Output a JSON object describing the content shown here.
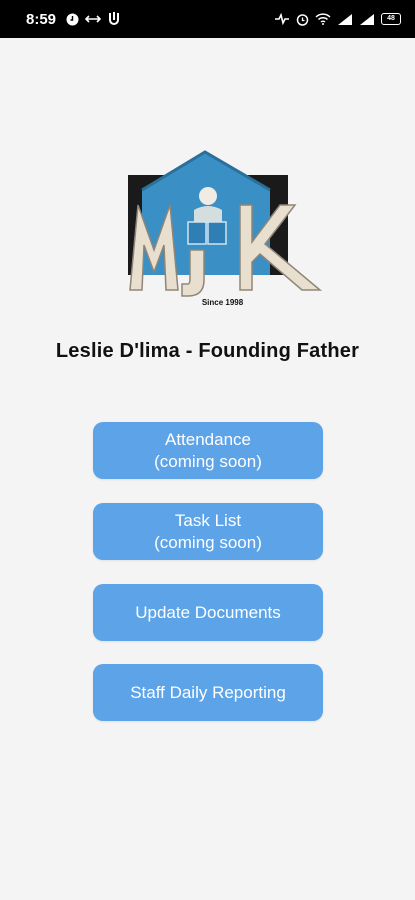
{
  "status_bar": {
    "time": "8:59",
    "battery": "48",
    "icons_left": [
      "clock-icon",
      "link-icon",
      "notification-icon"
    ],
    "icons_right": [
      "data-saver-icon",
      "alarm-icon",
      "wifi-icon",
      "signal-icon",
      "signal-icon"
    ]
  },
  "logo": {
    "letters": "MJK",
    "since": "Since 1998",
    "colors": {
      "house": "#3a8fc4",
      "letters": "#e9dfcf",
      "backdrop": "#1a1a1a"
    }
  },
  "page_title": "Leslie D'lima - Founding Father",
  "menu": [
    {
      "line1": "Attendance",
      "line2": "(coming soon)"
    },
    {
      "line1": "Task List",
      "line2": "(coming soon)"
    },
    {
      "line1": "Update Documents",
      "line2": ""
    },
    {
      "line1": "Staff Daily Reporting",
      "line2": ""
    }
  ],
  "colors": {
    "button_bg": "#5ca3e8",
    "button_text": "#ffffff",
    "page_bg": "#f4f4f4"
  }
}
